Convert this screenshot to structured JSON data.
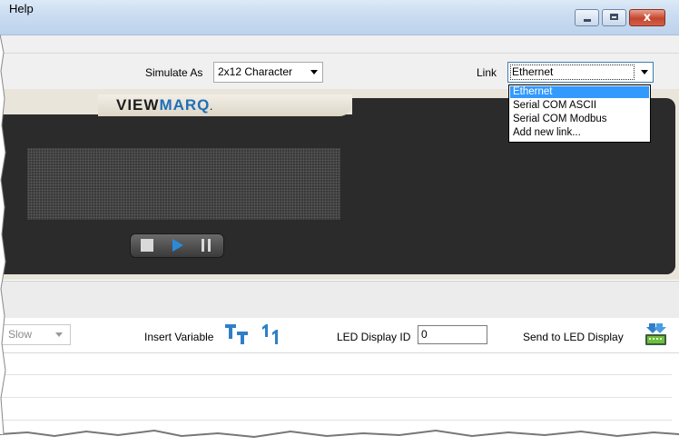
{
  "window": {
    "minimize_glyph": "",
    "maximize_glyph": "",
    "close_glyph": "x"
  },
  "menu": {
    "help_label": "Help"
  },
  "toolbar": {
    "simulate_label": "Simulate As",
    "simulate_value": "2x12 Character",
    "link_label": "Link",
    "link_value": "Ethernet"
  },
  "link_dropdown": {
    "options": [
      "Ethernet",
      "Serial COM ASCII",
      "Serial COM Modbus",
      "Add new link..."
    ],
    "highlighted_index": 0
  },
  "display_panel": {
    "brand_part1": "VIEW",
    "brand_part2": "MARQ",
    "brand_suffix": "."
  },
  "bottom_toolbar": {
    "speed_value": "Slow",
    "insert_variable_label": "Insert Variable",
    "led_display_id_label": "LED Display ID",
    "led_display_id_value": "0",
    "send_label": "Send to LED Display"
  },
  "colors": {
    "highlight": "#3399ff",
    "panel_dark": "#2b2b2b",
    "brand_blue": "#1f6fb8",
    "play_blue": "#2a8ad8"
  },
  "icons": [
    "minimize-icon",
    "maximize-icon",
    "close-icon",
    "dropdown-arrow-icon",
    "stop-icon",
    "play-icon",
    "pause-icon",
    "insert-text-variable-icon",
    "insert-number-variable-icon",
    "send-to-display-icon"
  ]
}
